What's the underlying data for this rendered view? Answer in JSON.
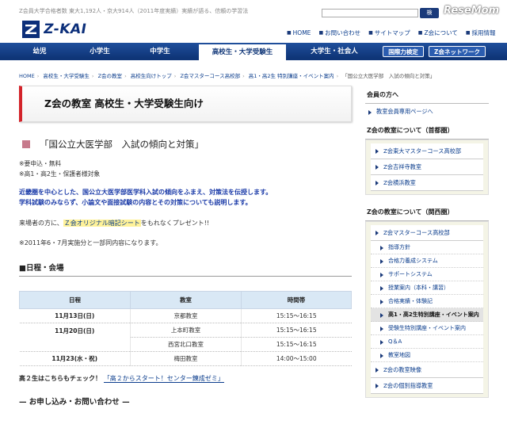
{
  "header": {
    "tagline": "Z会員大学合格者数 東大1,192人・京大914人（2011年度実績）実績が語る、信頼の学習法",
    "search_button": "検",
    "watermark": "ReseMom",
    "logo_text": "Z-KAI",
    "util_nav": [
      "HOME",
      "お問い合わせ",
      "サイトマップ",
      "Z会について",
      "採用情報"
    ]
  },
  "global_nav": {
    "items": [
      "幼児",
      "小学生",
      "中学生",
      "高校生・大学受験生",
      "大学生・社会人"
    ],
    "pills": [
      "国際力検定",
      "Z会ネットワーク"
    ]
  },
  "breadcrumb": [
    "HOME",
    "高校生・大学受験生",
    "Z会の教室",
    "高校生向けトップ",
    "Z会マスターコース高校部",
    "高1・高2生 特別講座・イベント案内",
    "「国公立大医学部　入試の傾向と対策」"
  ],
  "main": {
    "section_title": "Z会の教室 高校生・大学受験生向け",
    "event_title": "「国公立大医学部　入試の傾向と対策」",
    "notes": [
      "※要申込・無料",
      "※高1・高2生・保護者様対象"
    ],
    "description": [
      "近畿圏を中心とした、国公立大医学部医学科入試の傾向をふまえ、対策法を伝授します。",
      "学科試験のみならず、小論文や面接試験の内容とその対策についても説明します。"
    ],
    "gift_prefix": "来場者の方に、",
    "gift_highlight": "Ｚ会オリジナル暗記シート",
    "gift_suffix": "をもれなくプレゼント!!",
    "past_note": "※2011年6・7月実施分と一部同内容になります。",
    "schedule_heading": "■日程・会場",
    "schedule": {
      "headers": [
        "日程",
        "教室",
        "時間帯"
      ],
      "rows": [
        {
          "date": "11月13日(日)",
          "room": "京都教室",
          "time": "15:15～16:15"
        },
        {
          "date": "11月20日(日)",
          "room": "上本町教室",
          "time": "15:15～16:15"
        },
        {
          "date": "",
          "room": "西宮北口教室",
          "time": "15:15～16:15"
        },
        {
          "date": "11月23(水・祝)",
          "room": "梅田教室",
          "time": "14:00～15:00"
        }
      ]
    },
    "high2_label": "高２生はこちらもチェック！",
    "high2_link": "「高２からスタート！センター錬成ゼミ」",
    "apply_heading": "— お申し込み・お問い合わせ —"
  },
  "sidebar": {
    "members_heading": "会員の方へ",
    "members_link": "教室会員専用ページへ",
    "tokyo_heading": "Z会の教室について（首都圏）",
    "tokyo_items": [
      "Z会東大マスターコース高校部",
      "Z会吉祥寺教室",
      "Z会横浜教室"
    ],
    "kansai_heading": "Z会の教室について（関西圏）",
    "kansai_main": "Z会マスターコース高校部",
    "kansai_subs": [
      "指導方針",
      "合格力養成システム",
      "サポートシステム",
      "授業案内（本科・講習）",
      "合格実績・体験記",
      "高1・高2生特別講座・イベント案内",
      "受験生特別講座・イベント案内",
      "Q＆A",
      "教室地図"
    ],
    "kansai_more": [
      "Z会の教室映像",
      "Z会の個別指導教室"
    ]
  }
}
